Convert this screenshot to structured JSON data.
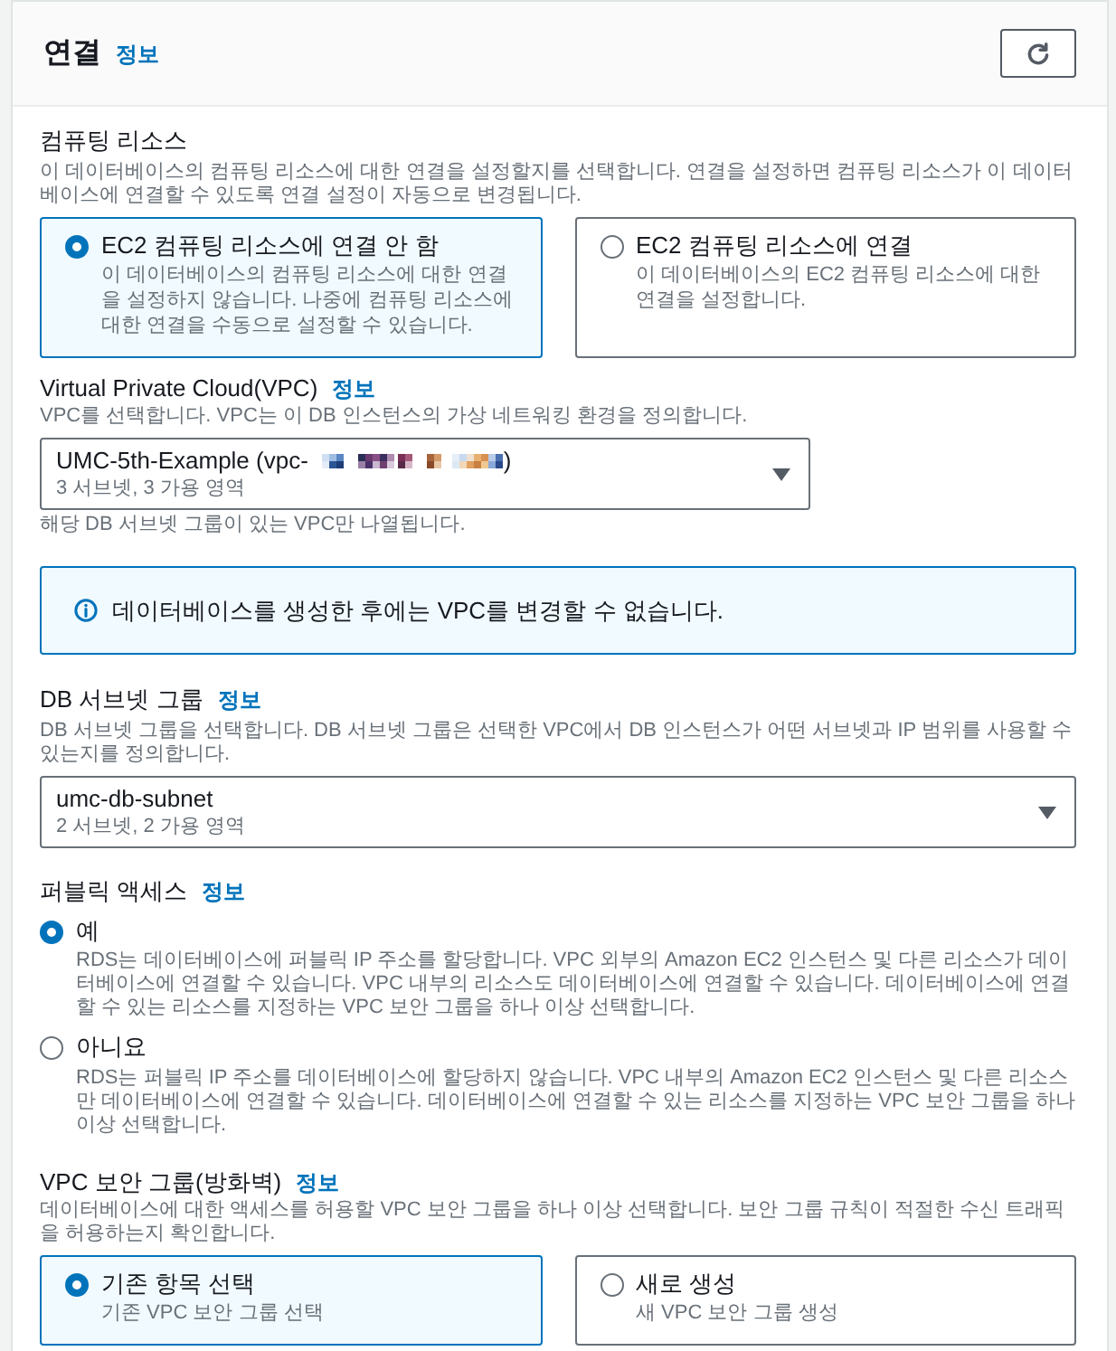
{
  "panel": {
    "title": "연결",
    "info_link": "정보",
    "header_buttons": [
      {
        "kind": "refresh"
      }
    ]
  },
  "compute_resource": {
    "label": "컴퓨팅 리소스",
    "description": "이 데이터베이스의 컴퓨팅 리소스에 대한 연결을 설정할지를 선택합니다. 연결을 설정하면 컴퓨팅 리소스가 이 데이터베이스에 연결할 수 있도록 연결 설정이 자동으로 변경됩니다.",
    "options": [
      {
        "title": "EC2 컴퓨팅 리소스에 연결 안 함",
        "description": "이 데이터베이스의 컴퓨팅 리소스에 대한 연결을 설정하지 않습니다. 나중에 컴퓨팅 리소스에 대한 연결을 수동으로 설정할 수 있습니다.",
        "selected": true
      },
      {
        "title": "EC2 컴퓨팅 리소스에 연결",
        "description": "이 데이터베이스의 EC2 컴퓨팅 리소스에 대한 연결을 설정합니다.",
        "selected": false
      }
    ]
  },
  "vpc": {
    "label": "Virtual Private Cloud(VPC)",
    "info_link": "정보",
    "description": "VPC를 선택합니다. VPC는 이 DB 인스턴스의 가상 네트워킹 환경을 정의합니다.",
    "select": {
      "value": "UMC-5th-Example (vpc-",
      "value_redacted": true,
      "value_end": ")",
      "detail": "3 서브넷, 3 가용 영역"
    },
    "hint": "해당 DB 서브넷 그룹이 있는 VPC만 나열됩니다."
  },
  "alert": {
    "kind": "info",
    "message": "데이터베이스를 생성한 후에는 VPC를 변경할 수 없습니다."
  },
  "db_subnet_group": {
    "label": "DB 서브넷 그룹",
    "info_link": "정보",
    "description": "DB 서브넷 그룹을 선택합니다. DB 서브넷 그룹은 선택한 VPC에서 DB 인스턴스가 어떤 서브넷과 IP 범위를 사용할 수 있는지를 정의합니다.",
    "select": {
      "value": "umc-db-subnet",
      "detail": "2 서브넷, 2 가용 영역"
    }
  },
  "public_access": {
    "label": "퍼블릭 액세스",
    "info_link": "정보",
    "options": [
      {
        "label": "예",
        "description": "RDS는 데이터베이스에 퍼블릭 IP 주소를 할당합니다. VPC 외부의 Amazon EC2 인스턴스 및 다른 리소스가 데이터베이스에 연결할 수 있습니다. VPC 내부의 리소스도 데이터베이스에 연결할 수 있습니다. 데이터베이스에 연결할 수 있는 리소스를 지정하는 VPC 보안 그룹을 하나 이상 선택합니다.",
        "selected": true
      },
      {
        "label": "아니요",
        "description": "RDS는 퍼블릭 IP 주소를 데이터베이스에 할당하지 않습니다. VPC 내부의 Amazon EC2 인스턴스 및 다른 리소스만 데이터베이스에 연결할 수 있습니다. 데이터베이스에 연결할 수 있는 리소스를 지정하는 VPC 보안 그룹을 하나 이상 선택합니다.",
        "selected": false
      }
    ]
  },
  "vpc_security_group": {
    "label": "VPC 보안 그룹(방화벽)",
    "info_link": "정보",
    "description": "데이터베이스에 대한 액세스를 허용할 VPC 보안 그룹을 하나 이상 선택합니다. 보안 그룹 규칙이 적절한 수신 트래픽을 허용하는지 확인합니다.",
    "options": [
      {
        "title": "기존 항목 선택",
        "description": "기존 VPC 보안 그룹 선택",
        "selected": true
      },
      {
        "title": "새로 생성",
        "description": "새 VPC 보안 그룹 생성",
        "selected": false
      }
    ]
  }
}
